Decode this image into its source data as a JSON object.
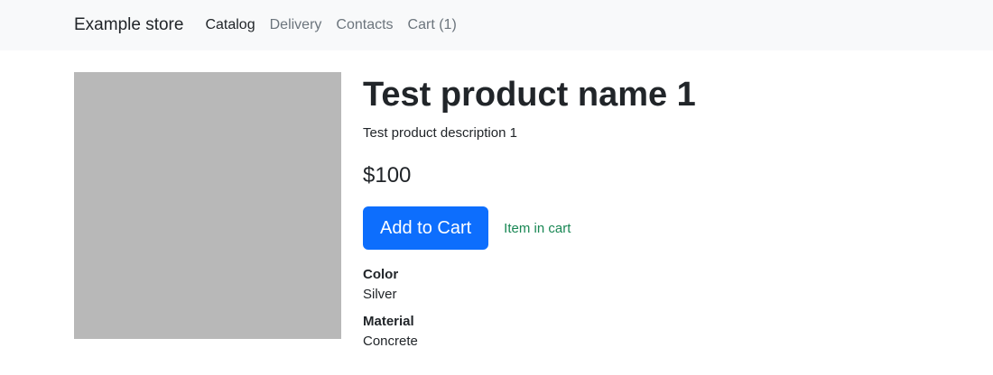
{
  "navbar": {
    "brand": "Example store",
    "links": [
      {
        "label": "Catalog",
        "active": true
      },
      {
        "label": "Delivery",
        "active": false
      },
      {
        "label": "Contacts",
        "active": false
      },
      {
        "label": "Cart (1)",
        "active": false
      }
    ]
  },
  "product": {
    "title": "Test product name 1",
    "description": "Test product description 1",
    "price": "$100",
    "add_to_cart_label": "Add to Cart",
    "cart_status": "Item in cart",
    "attributes": [
      {
        "name": "Color",
        "value": "Silver"
      },
      {
        "name": "Material",
        "value": "Concrete"
      }
    ]
  },
  "colors": {
    "navbar_bg": "#f8f9fa",
    "primary": "#0d6efd",
    "success_text": "#198754",
    "image_placeholder": "#b8b8b8"
  }
}
